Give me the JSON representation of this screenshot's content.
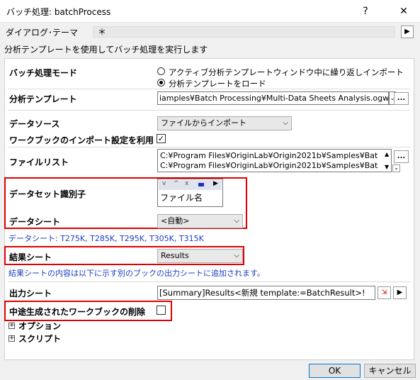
{
  "window": {
    "title": "バッチ処理: batchProcess",
    "help": "?",
    "close": "✕"
  },
  "theme": {
    "label": "ダイアログ･テーマ",
    "value": "＊",
    "menu_arrow": "▶"
  },
  "description": "分析テンプレートを使用してバッチ処理を実行します",
  "mode": {
    "label": "バッチ処理モード",
    "options": [
      {
        "label": "アクティブ分析テンプレートウィンドウ中に繰り返しインポート",
        "selected": false
      },
      {
        "label": "分析テンプレートをロード",
        "selected": true
      }
    ]
  },
  "template": {
    "label": "分析テンプレート",
    "value": "iamples¥Batch Processing¥Multi-Data Sheets Analysis.ogw",
    "browse": "..."
  },
  "datasource": {
    "label": "データソース",
    "value": "ファイルからインポート"
  },
  "import_settings": {
    "label": "ワークブックのインポート設定を利用",
    "checked": true
  },
  "filelist": {
    "label": "ファイルリスト",
    "lines": [
      "C:¥Program Files¥OriginLab¥Origin2021b¥Samples¥Bat",
      "C:¥Program Files¥OriginLab¥Origin2021b¥Samples¥Bat"
    ],
    "browse": "..."
  },
  "dataset_id": {
    "label": "データセット識別子",
    "value": "ファイル名"
  },
  "datasheet": {
    "label": "データシート",
    "value": "<自動>",
    "note": "データシート: T275K, T285K, T295K, T305K, T315K"
  },
  "result_sheet": {
    "label": "結果シート",
    "value": "Results",
    "note": "結果シートの内容は以下に示す別のブックの出力シートに追加されます。"
  },
  "output_sheet": {
    "label": "出力シート",
    "value": "[Summary]Results<新規 template:=BatchResult>!"
  },
  "delete_intermediate": {
    "label": "中途生成されたワークブックの削除",
    "checked": false
  },
  "sections": {
    "options": "オプション",
    "script": "スクリプト"
  },
  "buttons": {
    "ok": "OK",
    "cancel": "キャンセル"
  },
  "colors": {
    "highlight": "#e00000",
    "note_text": "#1c3fbf"
  }
}
